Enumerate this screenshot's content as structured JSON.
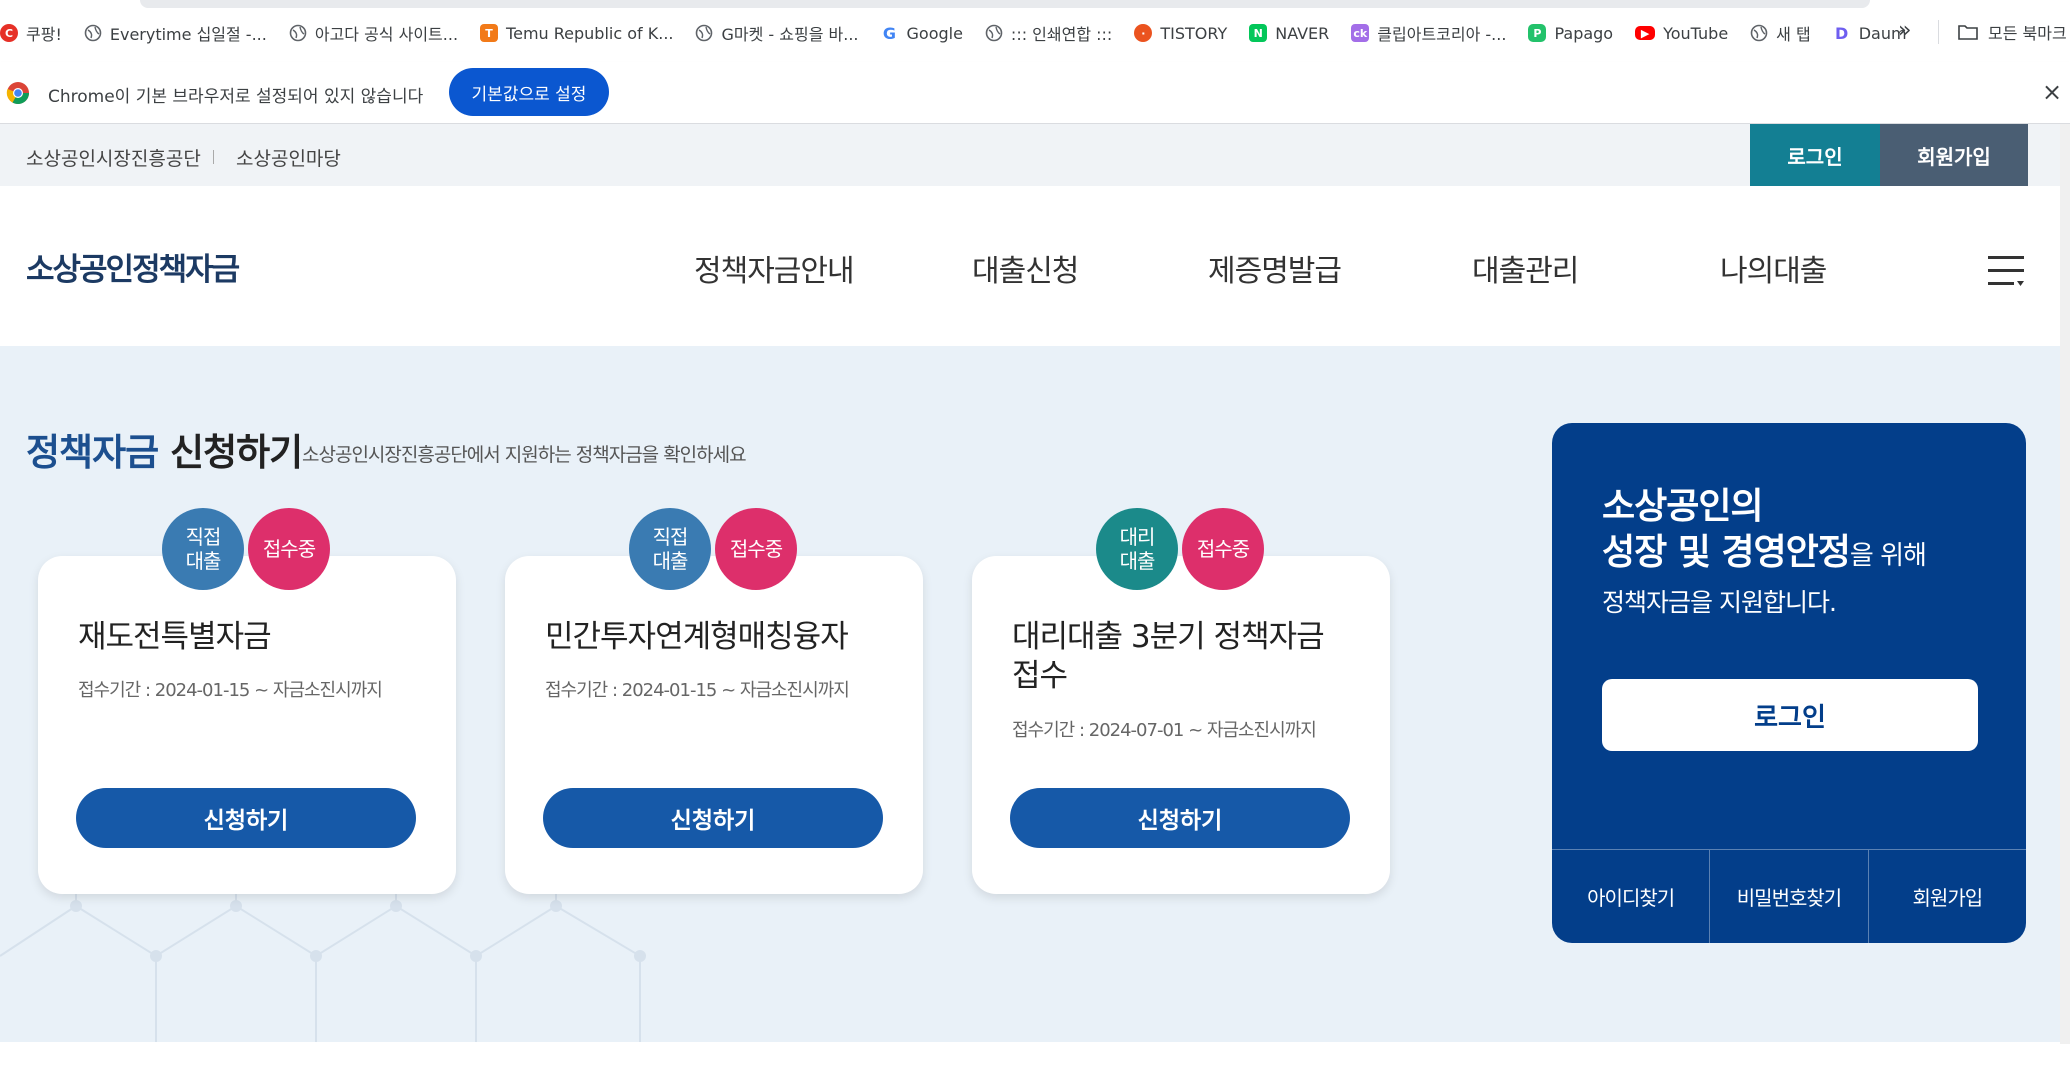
{
  "bookmarks": {
    "items": [
      {
        "label": "쿠팡!",
        "icon": "coupang-icon"
      },
      {
        "label": "Everytime 십일절 -...",
        "icon": "globe-icon"
      },
      {
        "label": "아고다 공식 사이트...",
        "icon": "globe-icon"
      },
      {
        "label": "Temu Republic of K...",
        "icon": "temu-icon"
      },
      {
        "label": "G마켓 - 쇼핑을 바...",
        "icon": "globe-icon"
      },
      {
        "label": "Google",
        "icon": "google-icon"
      },
      {
        "label": "::: 인쇄연합 :::",
        "icon": "globe-icon"
      },
      {
        "label": "TISTORY",
        "icon": "tistory-icon"
      },
      {
        "label": "NAVER",
        "icon": "naver-icon"
      },
      {
        "label": "클립아트코리아 -...",
        "icon": "clipartkorea-icon"
      },
      {
        "label": "Papago",
        "icon": "papago-icon"
      },
      {
        "label": "YouTube",
        "icon": "youtube-icon"
      },
      {
        "label": "새 탭",
        "icon": "globe-icon"
      },
      {
        "label": "Daum",
        "icon": "daum-icon"
      }
    ],
    "more": "»",
    "all_bookmarks": "모든 북마크"
  },
  "infobar": {
    "message": "Chrome이 기본 브라우저로 설정되어 있지 않습니다",
    "button": "기본값으로 설정",
    "close": "×"
  },
  "utilbar": {
    "link1": "소상공인시장진흥공단",
    "link2": "소상공인마당",
    "login": "로그인",
    "join": "회원가입"
  },
  "header": {
    "logo": "소상공인정책자금",
    "nav": [
      "정책자금안내",
      "대출신청",
      "제증명발급",
      "대출관리",
      "나의대출"
    ]
  },
  "main": {
    "title_accent": "정책자금",
    "title_rest": " 신청하기",
    "subtitle": "소상공인시장진흥공단에서 지원하는 정책자금을 확인하세요",
    "cards": [
      {
        "type_line1": "직접",
        "type_line2": "대출",
        "status": "접수중",
        "title": "재도전특별자금",
        "period": "접수기간 : 2024-01-15 ~ 자금소진시까지",
        "button": "신청하기"
      },
      {
        "type_line1": "직접",
        "type_line2": "대출",
        "status": "접수중",
        "title": "민간투자연계형매칭융자",
        "period": "접수기간 : 2024-01-15 ~ 자금소진시까지",
        "button": "신청하기"
      },
      {
        "type_line1": "대리",
        "type_line2": "대출",
        "status": "접수중",
        "title": "대리대출 3분기 정책자금 접수",
        "period": "접수기간 : 2024-07-01 ~ 자금소진시까지",
        "button": "신청하기"
      }
    ]
  },
  "side": {
    "line1": "소상공인의",
    "line2_bold": "성장 및 경영안정",
    "line2_small": "을 위해",
    "line3": "정책자금을 지원합니다.",
    "login": "로그인",
    "links": [
      "아이디찾기",
      "비밀번호찾기",
      "회원가입"
    ]
  },
  "colors": {
    "brand_navy": "#033e8a",
    "button_blue": "#1659a8",
    "teal": "#137f93",
    "status_pink": "#dd2f6b"
  }
}
